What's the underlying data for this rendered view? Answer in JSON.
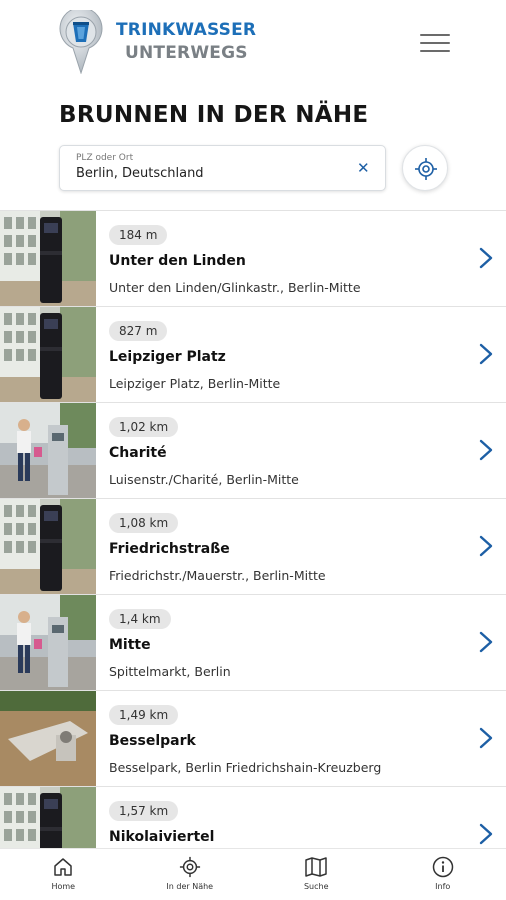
{
  "header": {
    "logo_line1": "TRINKWASSER",
    "logo_line2": "UNTERWEGS",
    "menu_icon": "hamburger-menu-icon",
    "brand_color": "#1d6fb8"
  },
  "page_title": "BRUNNEN IN DER NÄHE",
  "search": {
    "label": "PLZ oder Ort",
    "value": "Berlin, Deutschland",
    "clear_icon": "close-icon",
    "locate_icon": "crosshair-location-icon"
  },
  "fountains": [
    {
      "distance": "184 m",
      "name": "Unter den Linden",
      "address": "Unter den Linden/Glinkastr., Berlin-Mitte",
      "photo": "pillar"
    },
    {
      "distance": "827 m",
      "name": "Leipziger Platz",
      "address": "Leipziger Platz, Berlin-Mitte",
      "photo": "pillar"
    },
    {
      "distance": "1,02 km",
      "name": "Charité",
      "address": "Luisenstr./Charité, Berlin-Mitte",
      "photo": "street"
    },
    {
      "distance": "1,08 km",
      "name": "Friedrichstraße",
      "address": "Friedrichstr./Mauerstr., Berlin-Mitte",
      "photo": "pillar"
    },
    {
      "distance": "1,4 km",
      "name": "Mitte",
      "address": "Spittelmarkt, Berlin",
      "photo": "street"
    },
    {
      "distance": "1,49 km",
      "name": "Besselpark",
      "address": "Besselpark, Berlin Friedrichshain-Kreuzberg",
      "photo": "park"
    },
    {
      "distance": "1,57 km",
      "name": "Nikolaiviertel",
      "address": "",
      "photo": "pillar"
    }
  ],
  "bottom_nav": [
    {
      "label": "Home",
      "icon": "home-icon"
    },
    {
      "label": "In der Nähe",
      "icon": "nearby-target-icon"
    },
    {
      "label": "Suche",
      "icon": "map-icon"
    },
    {
      "label": "Info",
      "icon": "info-icon"
    }
  ]
}
